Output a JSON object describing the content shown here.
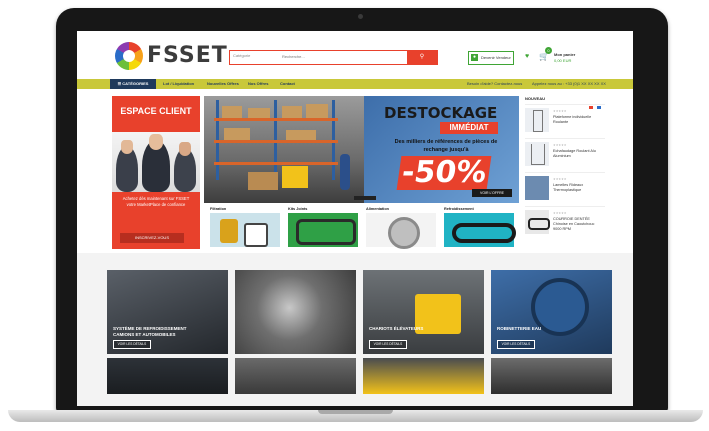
{
  "header": {
    "logo_text": "FSSET",
    "search_category": "Catégorie",
    "search_placeholder": "Recherche...",
    "search_button_icon": "search-icon",
    "quote_label": "Devenir Vendeur",
    "cart_count": "0",
    "cart_label": "Mon panier",
    "cart_total": "0,00 EUR"
  },
  "nav": {
    "categories": "CATÉGORIES",
    "items": [
      "Lot / Liquidation",
      "Nouvelles Offres",
      "Nos Offres",
      "Contact"
    ],
    "right_links": [
      "Besoin d'aide? Contactez-nous",
      "Appelez nous au : +33 (0)1 XX XX XX XX"
    ]
  },
  "espace_client": {
    "title": "ESPACE CLIENT",
    "text": "Achetez dès maintenant sur FSSET votre MarketPlace de confiance",
    "button": "INSCRIVEZ-VOUS"
  },
  "hero": {
    "title": "DESTOCKAGE",
    "badge": "IMMÉDIAT",
    "subtitle": "Des milliers de références de pièces de rechange jusqu'à",
    "percent": "-50%",
    "button": "VOIR L'OFFRE"
  },
  "categories": [
    {
      "label": "Filtration"
    },
    {
      "label": "Kits Joints"
    },
    {
      "label": "Alimentation"
    },
    {
      "label": "Refroidissement"
    }
  ],
  "nouveau": {
    "title": "NOUVEAU",
    "items": [
      {
        "name": "Plateforme individuelle Roulante"
      },
      {
        "name": "Echafaudage Roulant Alu Aluminium"
      },
      {
        "name": "Lamelles Rideaux Thermoplastique"
      },
      {
        "name": "COURROIE DENTÉE Chinoise en Caoutchouc 9000 RPM"
      }
    ]
  },
  "tiles": [
    {
      "label": "SYSTÈME DE REFROIDISSEMENT CAMIONS ET AUTOMOBILES",
      "button": "VOIR LES DÉTAILS",
      "color": "#3a3f45"
    },
    {
      "label": "",
      "button": "",
      "color": "#4b4f52"
    },
    {
      "label": "CHARIOTS ÉLÉVATEURS",
      "button": "VOIR LES DÉTAILS",
      "color": "#5a5f63"
    },
    {
      "label": "ROBINETTERIE EAU",
      "button": "VOIR LES DÉTAILS",
      "color": "#2f4f79"
    }
  ],
  "colors": {
    "brand_red": "#e8412c",
    "brand_green": "#3fa535",
    "nav_yellow": "#c9c83a",
    "nav_blue": "#1f3a5c"
  }
}
